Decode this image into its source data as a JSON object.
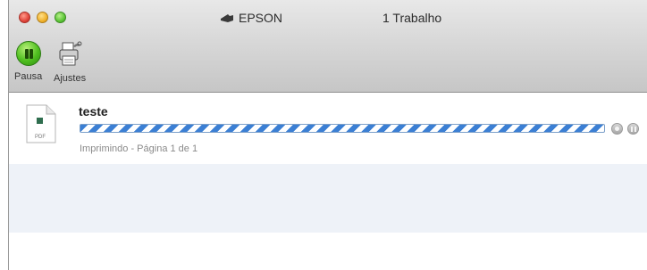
{
  "window": {
    "printer_name": "EPSON",
    "job_count": "1 Trabalho"
  },
  "toolbar": {
    "pause_label": "Pausa",
    "settings_label": "Ajustes"
  },
  "jobs": [
    {
      "name": "teste",
      "file_type": "PDF",
      "status": "Imprimindo - Página 1 de 1",
      "progress": "indeterminate"
    }
  ],
  "colors": {
    "progress_stripe": "#3b7fd4",
    "pause_green": "#4fbf1f",
    "alt_row": "#eef2f8"
  }
}
